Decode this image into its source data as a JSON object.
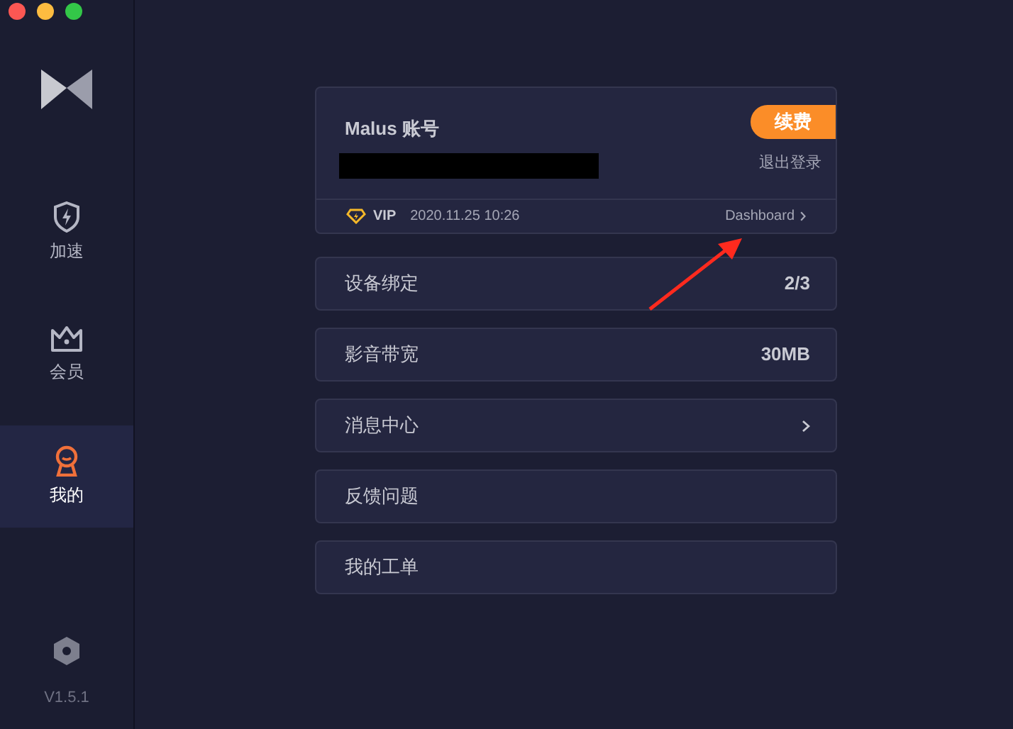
{
  "sidebar": {
    "items": [
      {
        "kind": "boost",
        "label": "加速",
        "selected": false
      },
      {
        "kind": "member",
        "label": "会员",
        "selected": false
      },
      {
        "kind": "mine",
        "label": "我的",
        "selected": true
      }
    ],
    "version": "V1.5.1"
  },
  "account": {
    "title": "Malus 账号",
    "renew_button": "续费",
    "logout_link": "退出登录",
    "vip_label": "VIP",
    "vip_expiry": "2020.11.25 10:26",
    "dashboard_link": "Dashboard"
  },
  "menu": [
    {
      "kind": "value",
      "label": "设备绑定",
      "value": "2/3"
    },
    {
      "kind": "value",
      "label": "影音带宽",
      "value": "30MB"
    },
    {
      "kind": "link",
      "label": "消息中心"
    },
    {
      "kind": "plain",
      "label": "反馈问题"
    },
    {
      "kind": "plain",
      "label": "我的工单"
    }
  ]
}
